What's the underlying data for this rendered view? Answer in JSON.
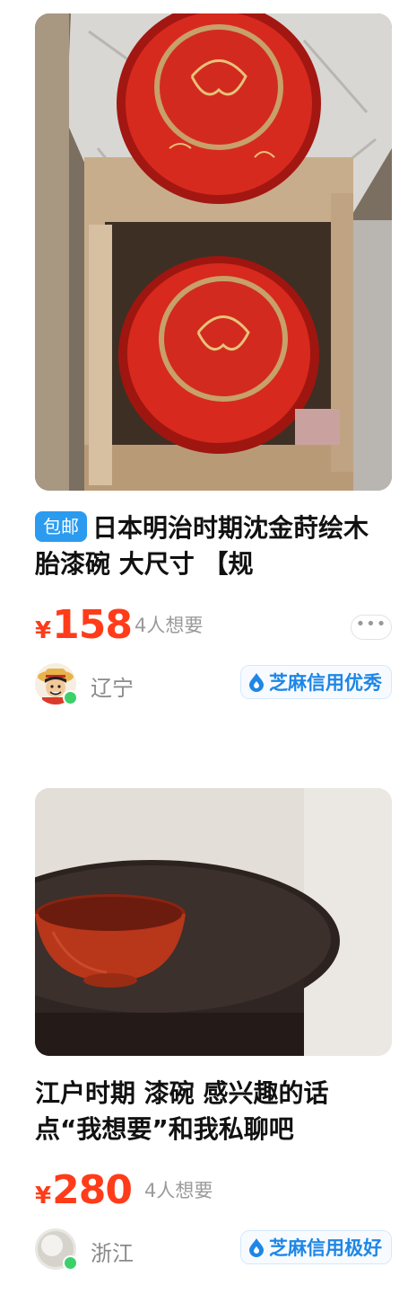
{
  "items": [
    {
      "badge": "包邮",
      "title": "日本明治时期沈金莳绘木胎漆碗 大尺寸 【规",
      "price_currency": "¥",
      "price": "158",
      "want": "4人想要",
      "more": "•••",
      "location": "辽宁",
      "credit": "芝麻信用优秀"
    },
    {
      "badge": "",
      "title": "江户时期 漆碗 感兴趣的话点“我想要”和我私聊吧",
      "price_currency": "¥",
      "price": "280",
      "want": "4人想要",
      "more": "",
      "location": "浙江",
      "credit": "芝麻信用极好"
    }
  ],
  "icons": {
    "credit": "sesame-drop-icon",
    "more": "more-dots-icon",
    "online": "online-status-icon"
  },
  "colors": {
    "price": "#ff3c1a",
    "badge": "#2b9bf0",
    "credit": "#1e86e6",
    "online": "#3cd06b"
  }
}
